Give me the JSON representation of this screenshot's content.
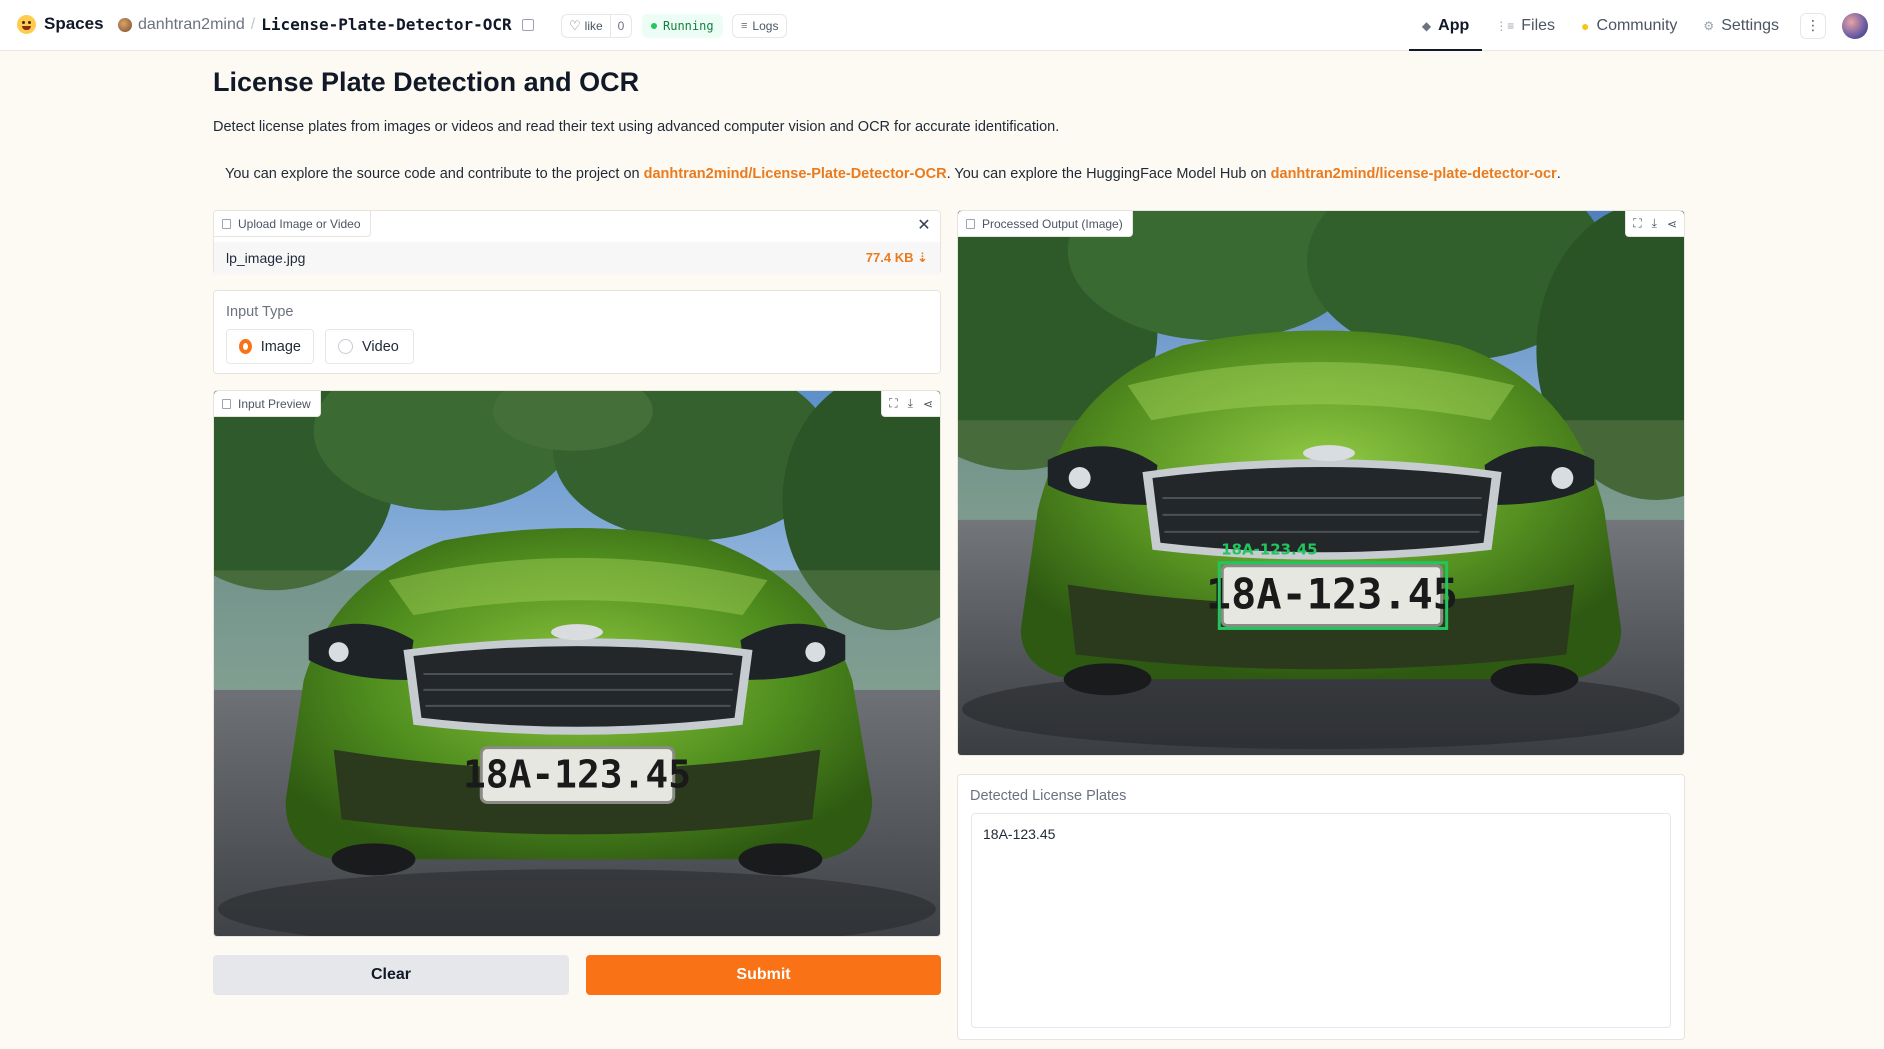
{
  "header": {
    "brand": "Spaces",
    "owner": "danhtran2mind",
    "separator": "/",
    "repo": "License-Plate-Detector-OCR",
    "like_label": "like",
    "like_count": "0",
    "status": "Running",
    "logs_label": "Logs",
    "nav": {
      "app": "App",
      "files": "Files",
      "community": "Community",
      "settings": "Settings"
    }
  },
  "page": {
    "title": "License Plate Detection and OCR",
    "description": "Detect license plates from images or videos and read their text using advanced computer vision and OCR for accurate identification.",
    "links": {
      "text1": "You can explore the source code and contribute to the project on ",
      "link1": "danhtran2mind/License-Plate-Detector-OCR",
      "text2": ". You can explore the HuggingFace Model Hub on ",
      "link2": "danhtran2mind/license-plate-detector-ocr",
      "text3": "."
    }
  },
  "upload": {
    "label": "Upload Image or Video",
    "filename": "lp_image.jpg",
    "size": "77.4 KB ⇣"
  },
  "input_type": {
    "label": "Input Type",
    "options": [
      "Image",
      "Video"
    ],
    "selected": "Image"
  },
  "input_preview": {
    "label": "Input Preview",
    "plate_text": "18A-123.45"
  },
  "output": {
    "label": "Processed Output (Image)",
    "plate_text": "18A-123.45",
    "overlay_text": "18A-123.45",
    "box_color": "#22c55e"
  },
  "detected": {
    "label": "Detected License Plates",
    "value": "18A-123.45"
  },
  "buttons": {
    "clear": "Clear",
    "submit": "Submit"
  },
  "colors": {
    "accent": "#f97316",
    "link": "#ea7a1e",
    "background": "#fdfaf3"
  }
}
